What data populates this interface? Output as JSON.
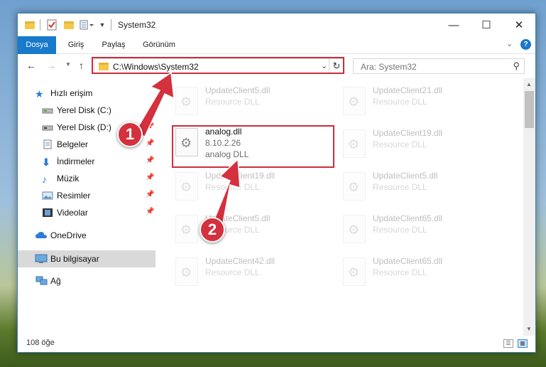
{
  "window": {
    "title": "System32",
    "controls": {
      "minimize": "—",
      "maximize": "☐",
      "close": "✕"
    }
  },
  "ribbon": {
    "tabs": [
      "Dosya",
      "Giriş",
      "Paylaş",
      "Görünüm"
    ]
  },
  "address": {
    "path": "C:\\Windows\\System32",
    "search_placeholder": "Ara: System32"
  },
  "sidebar": {
    "quick_access": "Hızlı erişim",
    "items": [
      {
        "label": "Yerel Disk (C:)",
        "icon": "drive-icon",
        "pinned": false
      },
      {
        "label": "Yerel Disk (D:)",
        "icon": "drive-icon",
        "pinned": true
      },
      {
        "label": "Belgeler",
        "icon": "documents-icon",
        "pinned": true
      },
      {
        "label": "İndirmeler",
        "icon": "download-icon",
        "pinned": true
      },
      {
        "label": "Müzik",
        "icon": "music-icon",
        "pinned": true
      },
      {
        "label": "Resimler",
        "icon": "pictures-icon",
        "pinned": true
      },
      {
        "label": "Videolar",
        "icon": "videos-icon",
        "pinned": true
      }
    ],
    "onedrive": "OneDrive",
    "this_pc": "Bu bilgisayar",
    "network": "Ağ"
  },
  "files": {
    "highlighted": {
      "name": "analog.dll",
      "version": "8.10.2.26",
      "description": "analog DLL"
    },
    "left_column": [
      {
        "name": "UpdateClient5.dll",
        "description": "Resource DLL"
      },
      {
        "name": "UpdateClient19.dll",
        "description": "Resource DLL"
      },
      {
        "name": "UpdateClient5.dll",
        "description": "Resource DLL"
      },
      {
        "name": "UpdateClient42.dll",
        "description": "Resource DLL"
      }
    ],
    "right_column": [
      {
        "name": "UpdateClient21.dll",
        "description": "Resource DLL"
      },
      {
        "name": "UpdateClient19.dll",
        "description": "Resource DLL"
      },
      {
        "name": "UpdateClient5.dll",
        "description": "Resource DLL"
      },
      {
        "name": "UpdateClient65.dll",
        "description": "Resource DLL"
      },
      {
        "name": "UpdateClient65.dll",
        "description": "Resource DLL"
      }
    ]
  },
  "status": {
    "item_count": "108 öğe"
  },
  "callouts": [
    "1",
    "2"
  ],
  "colors": {
    "accent": "#1979ca",
    "highlight": "#cc2d3b",
    "callout": "#d5303e"
  }
}
